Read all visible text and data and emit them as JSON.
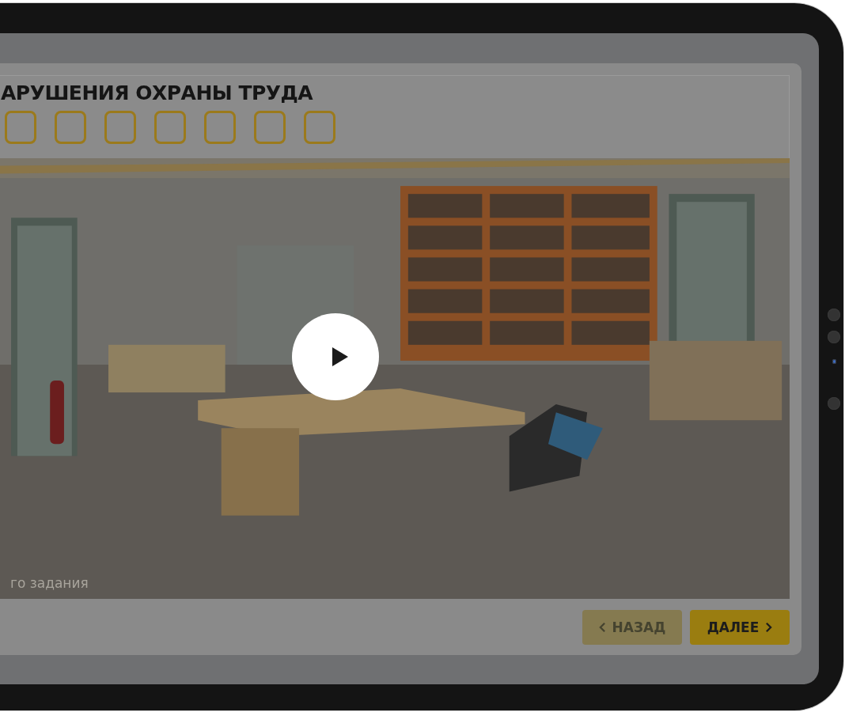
{
  "header": {
    "title": "АРУШЕНИЯ ОХРАНЫ ТРУДА",
    "violation_slots": [
      {
        "found": false
      },
      {
        "found": false
      },
      {
        "found": false
      },
      {
        "found": false
      },
      {
        "found": false
      },
      {
        "found": false
      },
      {
        "found": false
      }
    ]
  },
  "video": {
    "caption": "го задания"
  },
  "buttons": [
    {
      "label": "НАЗАД",
      "kind": "back",
      "disabled": true
    },
    {
      "label": "ДАЛЕЕ",
      "kind": "next",
      "disabled": false
    }
  ]
}
